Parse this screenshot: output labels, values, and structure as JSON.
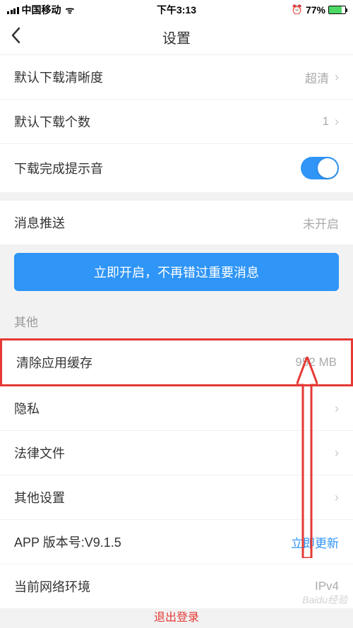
{
  "statusBar": {
    "carrier": "中国移动",
    "wifi": "ᯤ",
    "time": "下午3:13",
    "batteryPercent": "77%"
  },
  "nav": {
    "title": "设置"
  },
  "downloadGroup": {
    "defaultQuality": {
      "label": "默认下载清晰度",
      "value": "超清"
    },
    "defaultCount": {
      "label": "默认下载个数",
      "value": "1"
    },
    "completeSound": {
      "label": "下载完成提示音"
    }
  },
  "pushGroup": {
    "push": {
      "label": "消息推送",
      "value": "未开启"
    },
    "cta": "立即开启，不再错过重要消息"
  },
  "otherHeader": "其他",
  "otherGroup": {
    "clearCache": {
      "label": "清除应用缓存",
      "value": "952 MB"
    },
    "privacy": {
      "label": "隐私"
    },
    "legal": {
      "label": "法律文件"
    },
    "otherSettings": {
      "label": "其他设置"
    },
    "appVersion": {
      "label": "APP 版本号:V9.1.5",
      "value": "立即更新"
    },
    "network": {
      "label": "当前网络环境",
      "value": "IPv4"
    }
  },
  "bottomPartial": "退出登录",
  "watermark": "Baidu经验"
}
